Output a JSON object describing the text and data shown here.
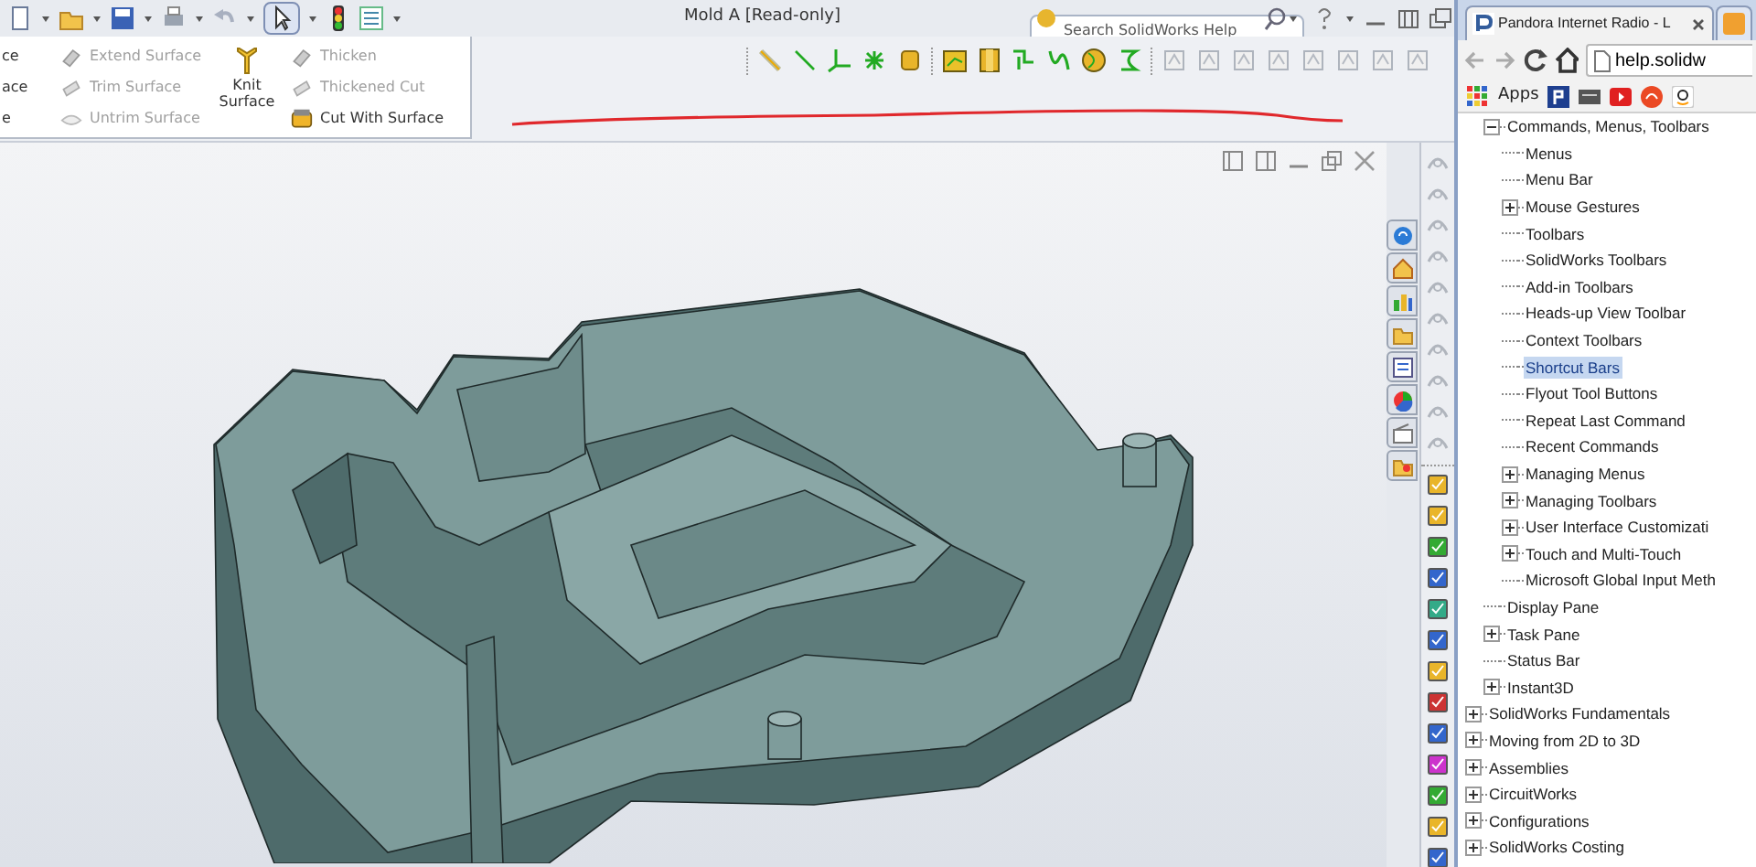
{
  "title_bar": {
    "title": "Mold A [Read-only]",
    "search": {
      "placeholder": "Search SolidWorks Help"
    }
  },
  "ribbon": {
    "groups": [
      {
        "kind": "text_only",
        "items": [
          {
            "label": "ce",
            "disabled": false
          },
          {
            "label": "ace",
            "disabled": false
          },
          {
            "label": "e",
            "disabled": false
          }
        ]
      },
      {
        "kind": "small",
        "items": [
          {
            "label": "Extend Surface",
            "disabled": true
          },
          {
            "label": "Trim Surface",
            "disabled": true
          },
          {
            "label": "Untrim Surface",
            "disabled": true
          }
        ]
      },
      {
        "kind": "large",
        "items": [
          {
            "label": "Knit Surface",
            "disabled": false
          }
        ]
      },
      {
        "kind": "small",
        "items": [
          {
            "label": "Thicken",
            "disabled": true
          },
          {
            "label": "Thickened Cut",
            "disabled": true
          },
          {
            "label": "Cut With Surface",
            "disabled": false
          }
        ]
      }
    ]
  },
  "browser": {
    "tab": {
      "title": "Pandora Internet Radio - L"
    },
    "address": "help.solidw",
    "bookmarks": [
      {
        "label": "Apps"
      }
    ],
    "tree": {
      "continued_items": [
        {
          "label": "Commands, Menus, Toolbars",
          "expanded": true,
          "selected": false,
          "children": [
            {
              "label": "Menus",
              "selected": false
            },
            {
              "label": "Menu Bar",
              "selected": false
            },
            {
              "label": "Mouse Gestures",
              "expanded": false,
              "selected": false
            },
            {
              "label": "Toolbars",
              "selected": false
            },
            {
              "label": "SolidWorks Toolbars",
              "selected": false
            },
            {
              "label": "Add-in Toolbars",
              "selected": false
            },
            {
              "label": "Heads-up View Toolbar",
              "selected": false
            },
            {
              "label": "Context Toolbars",
              "selected": false
            },
            {
              "label": "Shortcut Bars",
              "selected": true
            },
            {
              "label": "Flyout Tool Buttons",
              "selected": false
            },
            {
              "label": "Repeat Last Command",
              "selected": false
            },
            {
              "label": "Recent Commands",
              "selected": false
            },
            {
              "label": "Managing Menus",
              "expanded": false,
              "selected": false
            },
            {
              "label": "Managing Toolbars",
              "expanded": false,
              "selected": false
            },
            {
              "label": "User Interface Customizati",
              "expanded": false,
              "selected": false
            },
            {
              "label": "Touch and Multi-Touch",
              "expanded": false,
              "selected": false
            },
            {
              "label": "Microsoft Global Input Meth",
              "selected": false
            }
          ]
        },
        {
          "label": "Display Pane",
          "selected": false
        },
        {
          "label": "Task Pane",
          "expanded": false,
          "selected": false
        },
        {
          "label": "Status Bar",
          "selected": false
        },
        {
          "label": "Instant3D",
          "expanded": false,
          "selected": false
        }
      ],
      "items": [
        {
          "label": "SolidWorks Fundamentals",
          "expanded": false,
          "selected": false
        },
        {
          "label": "Moving from 2D to 3D",
          "expanded": false,
          "selected": false
        },
        {
          "label": "Assemblies",
          "expanded": false,
          "selected": false
        },
        {
          "label": "CircuitWorks",
          "expanded": false,
          "selected": false
        },
        {
          "label": "Configurations",
          "expanded": false,
          "selected": false
        },
        {
          "label": "SolidWorks Costing",
          "expanded": false,
          "selected": false
        }
      ]
    }
  }
}
